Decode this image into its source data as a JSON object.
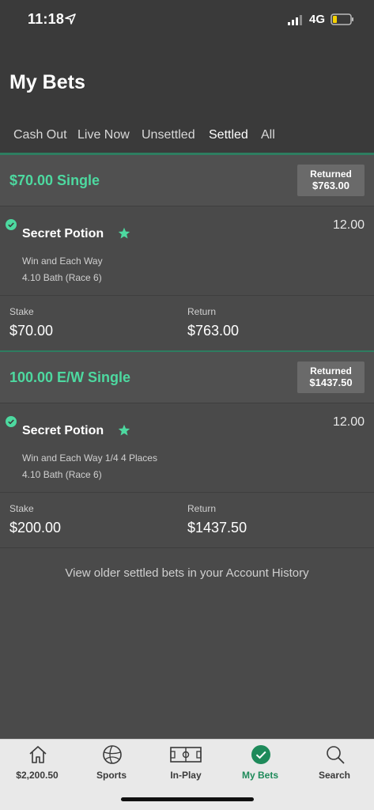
{
  "status_bar": {
    "time": "11:18",
    "network": "4G"
  },
  "header": {
    "title": "My Bets"
  },
  "tabs": [
    {
      "label": "Cash Out"
    },
    {
      "label": "Live Now"
    },
    {
      "label": "Unsettled"
    },
    {
      "label": "Settled",
      "active": true
    },
    {
      "label": "All"
    }
  ],
  "bets": [
    {
      "title": "$70.00 Single",
      "returned_label": "Returned",
      "returned_amount": "$763.00",
      "selection": "Secret Potion",
      "odds": "12.00",
      "market": "Win and Each Way",
      "event": "4.10 Bath (Race 6)",
      "stake_label": "Stake",
      "stake": "$70.00",
      "return_label": "Return",
      "return": "$763.00"
    },
    {
      "title": "100.00 E/W Single",
      "returned_label": "Returned",
      "returned_amount": "$1437.50",
      "selection": "Secret Potion",
      "odds": "12.00",
      "market": "Win and Each Way 1/4 4 Places",
      "event": "4.10 Bath (Race 6)",
      "stake_label": "Stake",
      "stake": "$200.00",
      "return_label": "Return",
      "return": "$1437.50"
    }
  ],
  "history_link": "View older settled bets in your Account History",
  "bottom_nav": [
    {
      "label": "$2,200.50",
      "icon": "home-icon"
    },
    {
      "label": "Sports",
      "icon": "football-icon"
    },
    {
      "label": "In-Play",
      "icon": "pitch-icon"
    },
    {
      "label": "My Bets",
      "icon": "check-circle-icon",
      "active": true
    },
    {
      "label": "Search",
      "icon": "search-icon"
    }
  ],
  "colors": {
    "accent": "#4dd9a0",
    "active_nav": "#1e8a5a",
    "header_bg": "#3a3a3a",
    "body_bg": "#4a4a4a"
  }
}
